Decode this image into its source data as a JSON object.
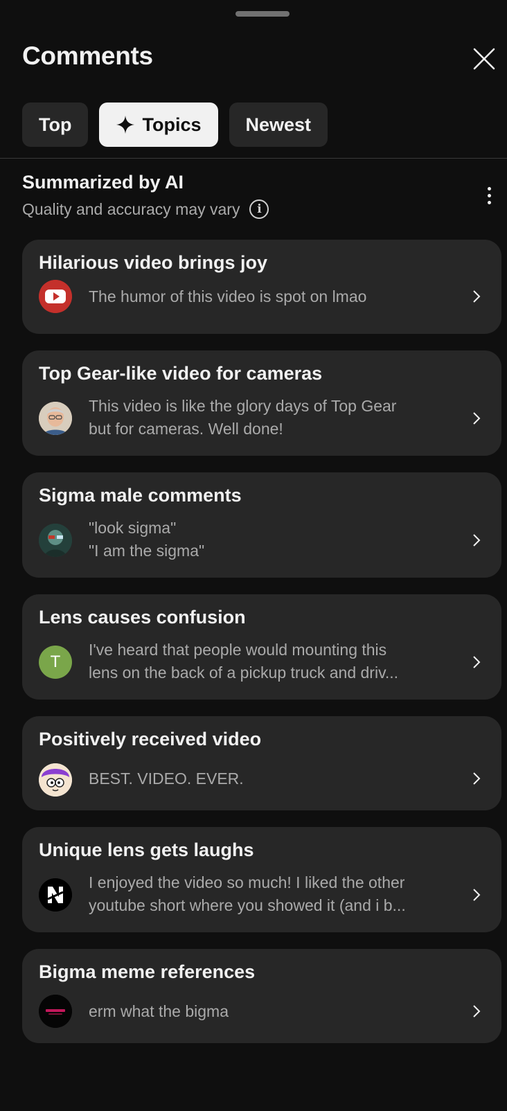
{
  "header": {
    "title": "Comments",
    "close_icon": "close-icon"
  },
  "tabs": [
    {
      "label": "Top",
      "active": false
    },
    {
      "label": "Topics",
      "active": true,
      "icon": "sparkle-icon"
    },
    {
      "label": "Newest",
      "active": false
    }
  ],
  "summary": {
    "title": "Summarized by AI",
    "subtitle": "Quality and accuracy may vary",
    "info_icon": "info-icon",
    "more_icon": "more-vert-icon"
  },
  "topics": [
    {
      "title": "Hilarious video brings joy",
      "avatar": "youtube-logo-avatar",
      "lines": [
        "The humor of this video is spot on lmao"
      ]
    },
    {
      "title": "Top Gear-like video for cameras",
      "avatar": "man-photo-avatar",
      "lines": [
        "This video is like the glory days of Top Gear",
        "but for cameras.  Well done!"
      ]
    },
    {
      "title": "Sigma male comments",
      "avatar": "teal-photo-avatar",
      "lines": [
        "\"look sigma\"",
        "\"I am the sigma\""
      ]
    },
    {
      "title": "Lens causes confusion",
      "avatar": "letter-avatar",
      "avatar_letter": "T",
      "lines": [
        "I've heard that people would mounting this",
        "lens on the back of a pickup truck and driv..."
      ]
    },
    {
      "title": "Positively received video",
      "avatar": "cartoon-face-avatar",
      "lines": [
        "BEST. VIDEO. EVER."
      ]
    },
    {
      "title": "Unique lens gets laughs",
      "avatar": "n-logo-avatar",
      "lines": [
        "I enjoyed the video so much! I liked the other",
        "youtube short where you showed it (and i b..."
      ]
    },
    {
      "title": "Bigma meme references",
      "avatar": "dark-logo-avatar",
      "lines": [
        "erm what the bigma"
      ]
    }
  ],
  "colors": {
    "background": "#0f0f0f",
    "card": "#272727",
    "primary_text": "#f1f1f1",
    "secondary_text": "#aaaaaa",
    "active_chip": "#f1f1f1",
    "letter_avatar": "#7aa64a",
    "youtube_red": "#c4302b"
  }
}
